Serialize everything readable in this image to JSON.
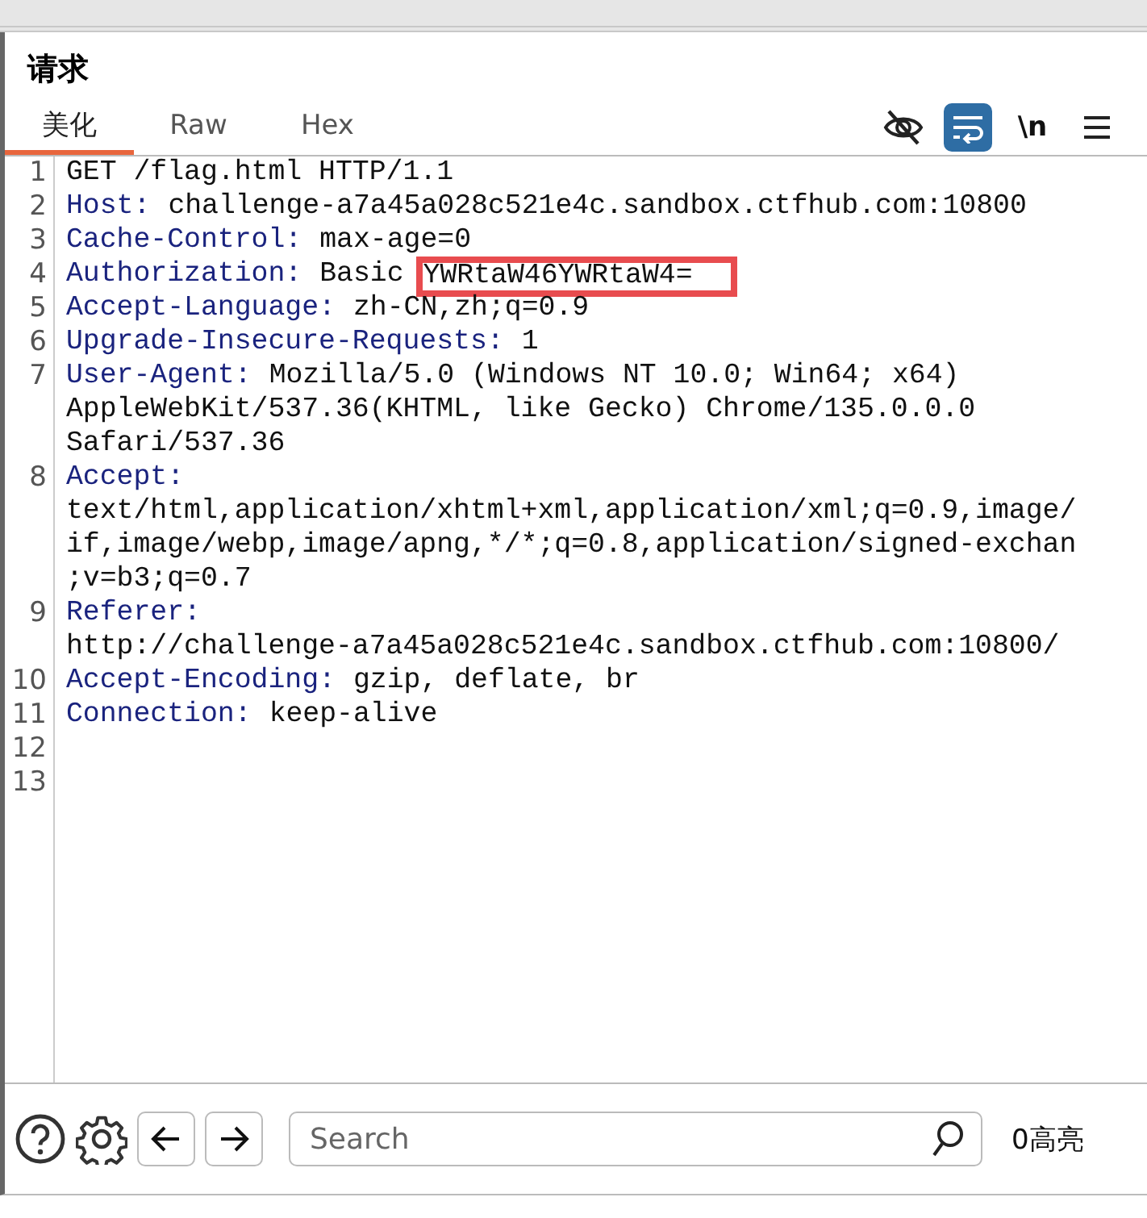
{
  "panel": {
    "title": "请求"
  },
  "tabs": [
    {
      "label": "美化",
      "selected": true
    },
    {
      "label": "Raw",
      "selected": false
    },
    {
      "label": "Hex",
      "selected": false
    }
  ],
  "tools": [
    {
      "kind": "hide",
      "on": false
    },
    {
      "kind": "wrap",
      "on": true
    },
    {
      "kind": "newline",
      "label": "\\n",
      "on": false
    },
    {
      "kind": "menu",
      "on": false
    }
  ],
  "lines": [
    {
      "number": "1",
      "rows": [
        {
          "value": "GET /flag.html HTTP/1.1"
        }
      ]
    },
    {
      "number": "2",
      "rows": [
        {
          "name": "Host:",
          "value": "challenge-a7a45a028c521e4c.sandbox.ctfhub.com:10800"
        }
      ]
    },
    {
      "number": "3",
      "rows": [
        {
          "name": "Cache-Control:",
          "value": "max-age=0"
        }
      ]
    },
    {
      "number": "4",
      "rows": [
        {
          "name": "Authorization:",
          "value": "Basic",
          "marked": "YWRtaW46YWRtaW4="
        }
      ]
    },
    {
      "number": "5",
      "rows": [
        {
          "name": "Accept-Language:",
          "value": "zh-CN,zh;q=0.9"
        }
      ]
    },
    {
      "number": "6",
      "rows": [
        {
          "name": "Upgrade-Insecure-Requests:",
          "value": "1"
        }
      ]
    },
    {
      "number": "7",
      "rows": [
        {
          "name": "User-Agent:",
          "value": "Mozilla/5.0 (Windows NT 10.0; Win64; x64)"
        },
        {
          "value": "AppleWebKit/537.36(KHTML, like Gecko) Chrome/135.0.0.0"
        },
        {
          "value": "Safari/537.36"
        }
      ]
    },
    {
      "number": "8",
      "rows": [
        {
          "name": "Accept:"
        },
        {
          "value": "text/html,application/xhtml+xml,application/xml;q=0.9,image/"
        },
        {
          "value": "if,image/webp,image/apng,*/*;q=0.8,application/signed-exchan"
        },
        {
          "value": ";v=b3;q=0.7"
        }
      ]
    },
    {
      "number": "9",
      "rows": [
        {
          "name": "Referer:"
        },
        {
          "value": "http://challenge-a7a45a028c521e4c.sandbox.ctfhub.com:10800/"
        }
      ]
    },
    {
      "number": "10",
      "rows": [
        {
          "name": "Accept-Encoding:",
          "value": "gzip, deflate, br"
        }
      ]
    },
    {
      "number": "11",
      "rows": [
        {
          "name": "Connection:",
          "value": "keep-alive"
        }
      ]
    },
    {
      "number": "12"
    },
    {
      "number": "13"
    }
  ],
  "search": {
    "placeholder": "Search"
  },
  "highlight_count": "0高亮"
}
